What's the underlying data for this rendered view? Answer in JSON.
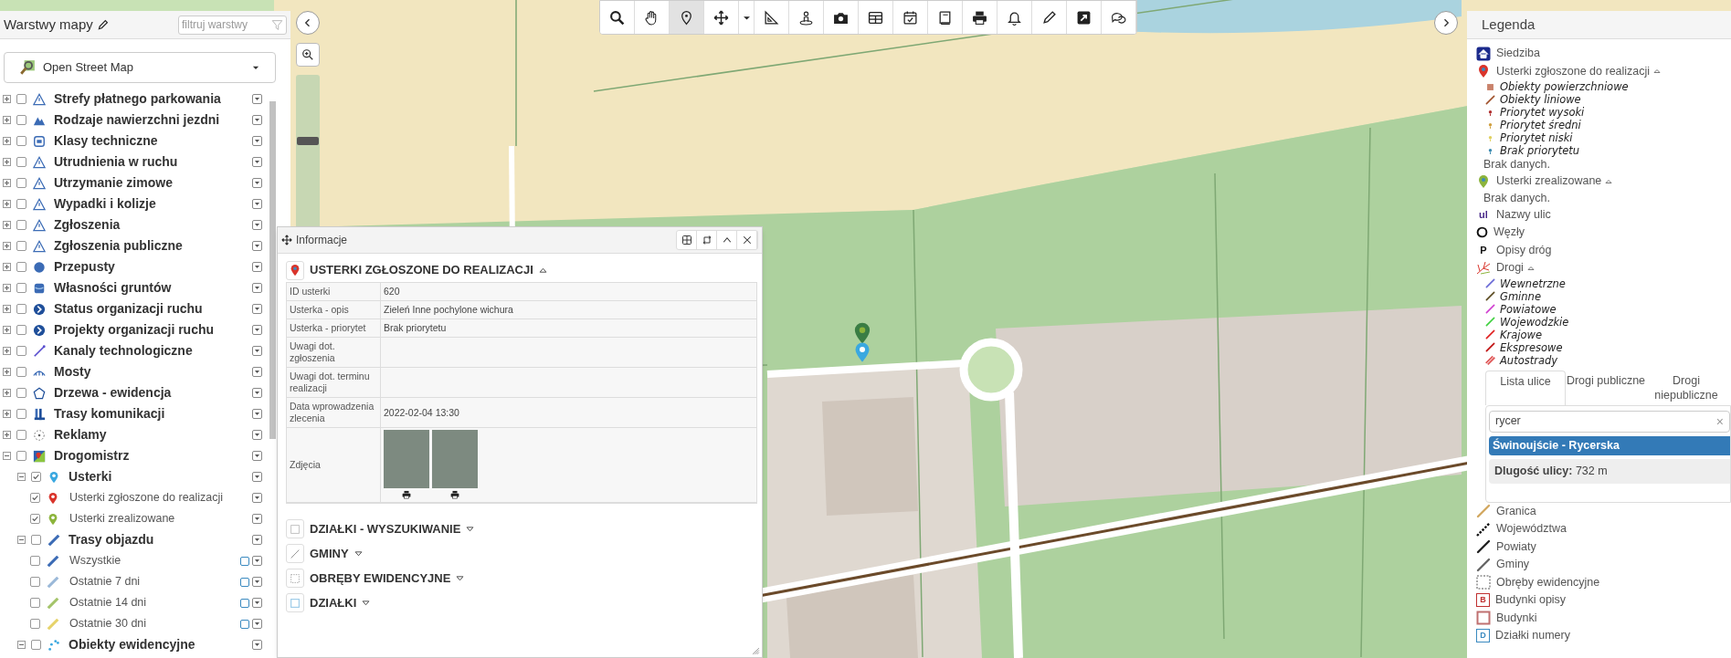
{
  "toolbar": [
    {
      "kind": "search",
      "selected": false
    },
    {
      "kind": "hand",
      "selected": false
    },
    {
      "kind": "pin",
      "selected": true
    },
    {
      "kind": "move",
      "selected": false
    },
    {
      "kind": "caret",
      "selected": false
    },
    {
      "kind": "ruler",
      "selected": false
    },
    {
      "kind": "person",
      "selected": false
    },
    {
      "kind": "camera",
      "selected": false
    },
    {
      "kind": "table",
      "selected": false
    },
    {
      "kind": "calendar",
      "selected": false
    },
    {
      "kind": "book",
      "selected": false
    },
    {
      "kind": "printer",
      "selected": false
    },
    {
      "kind": "bell",
      "selected": false
    },
    {
      "kind": "pencil",
      "selected": false
    },
    {
      "kind": "external",
      "selected": false
    },
    {
      "kind": "chat",
      "selected": false
    }
  ],
  "zoom_slider": {
    "level": 0.57
  },
  "layers_panel": {
    "title": "Warstwy mapy",
    "filter_placeholder": "filtruj warstwy",
    "basemap": "Open Street Map",
    "layers": [
      {
        "label": "Strefy płatnego parkowania",
        "kind": "warning",
        "expanded": false,
        "checked": false
      },
      {
        "label": "Rodzaje nawierzchni jezdni",
        "kind": "mountain",
        "expanded": false,
        "checked": false
      },
      {
        "label": "Klasy techniczne",
        "kind": "tech-class",
        "expanded": false,
        "checked": false
      },
      {
        "label": "Utrudnienia w ruchu",
        "kind": "warning",
        "expanded": false,
        "checked": false
      },
      {
        "label": "Utrzymanie zimowe",
        "kind": "warning",
        "expanded": false,
        "checked": false
      },
      {
        "label": "Wypadki i kolizje",
        "kind": "warning",
        "expanded": false,
        "checked": false
      },
      {
        "label": "Zgłoszenia",
        "kind": "warning",
        "expanded": false,
        "checked": false
      },
      {
        "label": "Zgłoszenia publiczne",
        "kind": "warning",
        "expanded": false,
        "checked": false
      },
      {
        "label": "Przepusty",
        "kind": "circle",
        "expanded": false,
        "checked": false
      },
      {
        "label": "Własności gruntów",
        "kind": "db",
        "expanded": false,
        "checked": false
      },
      {
        "label": "Status organizacji ruchu",
        "kind": "chevron",
        "expanded": false,
        "checked": false
      },
      {
        "label": "Projekty organizacji ruchu",
        "kind": "chevron",
        "expanded": false,
        "checked": false
      },
      {
        "label": "Kanaly technologiczne",
        "kind": "link",
        "expanded": false,
        "checked": false
      },
      {
        "label": "Mosty",
        "kind": "bridge",
        "expanded": false,
        "checked": false
      },
      {
        "label": "Drzewa - ewidencja",
        "kind": "polygon",
        "expanded": false,
        "checked": false
      },
      {
        "label": "Trasy komunikacji",
        "kind": "bus",
        "expanded": false,
        "checked": false
      },
      {
        "label": "Reklamy",
        "kind": "ad",
        "expanded": false,
        "checked": false
      },
      {
        "label": "Drogomistrz",
        "kind": "flag",
        "expanded": true,
        "checked": false,
        "children": [
          {
            "label": "Usterki",
            "kind": "pin",
            "color": "#3aa8e0",
            "expanded": true,
            "checked": true,
            "children": [
              {
                "label": "Usterki zgłoszone do realizacji",
                "kind": "pin",
                "color": "#d9342b",
                "checked": true
              },
              {
                "label": "Usterki zrealizowane",
                "kind": "pin",
                "color": "#8cb43c",
                "checked": true
              }
            ]
          },
          {
            "label": "Trasy objazdu",
            "kind": "line",
            "color": "#3b6bb5",
            "expanded": true,
            "checked": false,
            "children": [
              {
                "label": "Wszystkie",
                "kind": "line",
                "color": "#3b6bb5",
                "checked": false
              },
              {
                "label": "Ostatnie 7 dni",
                "kind": "line",
                "color": "#9ab8d8",
                "checked": false
              },
              {
                "label": "Ostatnie 14 dni",
                "kind": "line",
                "color": "#a4c46a",
                "checked": false
              },
              {
                "label": "Ostatnie 30 dni",
                "kind": "line",
                "color": "#e6d36a",
                "checked": false
              }
            ]
          },
          {
            "label": "Obiekty ewidencyjne",
            "kind": "dots",
            "color": "#3aa8e0",
            "expanded": true,
            "checked": false
          }
        ]
      }
    ]
  },
  "info_panel": {
    "title": "Informacje",
    "sections": [
      {
        "kind": "pin",
        "title": "USTERKI ZGŁOSZONE DO REALIZACJI",
        "expanded": true,
        "rows": [
          {
            "label": "ID usterki",
            "value": "620"
          },
          {
            "label": "Usterka - opis",
            "value": "Zieleń Inne pochylone wichura"
          },
          {
            "label": "Usterka - priorytet",
            "value": "Brak priorytetu"
          },
          {
            "label": "Uwagi dot. zgłoszenia"
          },
          {
            "label": "Uwagi dot. terminu realizacji"
          },
          {
            "label": "Data wprowadzenia zlecenia",
            "value": "2022-02-04 13:30"
          },
          {
            "label": "Zdjęcia",
            "photos": [
              {
                "printable": true
              },
              {
                "printable": true
              }
            ]
          }
        ]
      },
      {
        "kind": "square",
        "title": "DZIAŁKI - WYSZUKIWANIE",
        "expanded": false
      },
      {
        "kind": "line",
        "title": "GMINY",
        "expanded": false
      },
      {
        "kind": "dashed",
        "title": "OBRĘBY EWIDENCYJNE",
        "expanded": false
      },
      {
        "kind": "blue-square",
        "title": "DZIAŁKI",
        "expanded": false
      }
    ]
  },
  "legend": {
    "title": "Legenda",
    "entries_top": [
      {
        "kind": "house",
        "label": "Siedziba"
      },
      {
        "kind": "pin",
        "label": "Usterki zgłoszone do realizacji",
        "color": "#d9342b",
        "expanded": true,
        "items": [
          {
            "kind": "square",
            "label": "Obiekty powierzchniowe",
            "color": "#c9826b"
          },
          {
            "kind": "line",
            "label": "Obiekty liniowe",
            "color": "#a0522d"
          },
          {
            "kind": "dot",
            "label": "Priorytet wysoki",
            "color": "#b03030"
          },
          {
            "kind": "dot",
            "label": "Priorytet średni",
            "color": "#d0a040"
          },
          {
            "kind": "dot",
            "label": "Priorytet niski",
            "color": "#e0d060"
          },
          {
            "kind": "dot",
            "label": "Brak priorytetu",
            "color": "#3a8ab0"
          }
        ],
        "note": "Brak danych."
      },
      {
        "kind": "pin",
        "label": "Usterki zrealizowane",
        "color": "#8cb43c",
        "expanded": true,
        "note": "Brak danych."
      },
      {
        "kind": "glyph",
        "glyph": "ul",
        "label": "Nazwy ulic",
        "color": "#4a2a8a"
      },
      {
        "kind": "ring",
        "label": "Węzły"
      },
      {
        "kind": "glyph",
        "glyph": "P",
        "label": "Opisy dróg",
        "color": "#111111"
      },
      {
        "kind": "roads",
        "label": "Drogi",
        "expanded": true,
        "items": [
          {
            "kind": "line",
            "label": "Wewnetrzne",
            "color": "#6b6bd6"
          },
          {
            "kind": "line",
            "label": "Gminne",
            "color": "#5a4a20"
          },
          {
            "kind": "line",
            "label": "Powiatowe",
            "color": "#d040d0"
          },
          {
            "kind": "line",
            "label": "Wojewodzkie",
            "color": "#40d040"
          },
          {
            "kind": "line",
            "label": "Krajowe",
            "color": "#e02020"
          },
          {
            "kind": "line",
            "label": "Ekspresowe",
            "color": "#c01010"
          },
          {
            "kind": "double-line",
            "label": "Autostrady",
            "color": "#e05a5a"
          }
        ]
      }
    ],
    "street_panel": {
      "tabs": [
        {
          "label": "Lista ulice",
          "selected": true
        },
        {
          "label": "Drogi publiczne",
          "selected": false
        },
        {
          "label": "Drogi niepubliczne",
          "selected": false
        }
      ],
      "search": {
        "value": "rycer",
        "clear": "×"
      },
      "results": [
        {
          "label": "Świnoujście - Rycerska",
          "selected": true
        }
      ],
      "details": "**Dlugość ulicy:** 732 m"
    },
    "entries_bottom": [
      {
        "kind": "line",
        "label": "Granica",
        "color": "#d2a860"
      },
      {
        "kind": "dashed-line",
        "label": "Województwa"
      },
      {
        "kind": "line",
        "label": "Powiaty",
        "color": "#222222"
      },
      {
        "kind": "line",
        "label": "Gminy",
        "color": "#666666"
      },
      {
        "kind": "dashed-box",
        "label": "Obręby ewidencyjne"
      },
      {
        "kind": "badge",
        "glyph": "B",
        "label": "Budynki opisy",
        "color": "#c03030"
      },
      {
        "kind": "box",
        "label": "Budynki",
        "color": "#c07070"
      },
      {
        "kind": "badge",
        "glyph": "D",
        "label": "Działki numery",
        "color": "#3a8ac0"
      }
    ]
  }
}
